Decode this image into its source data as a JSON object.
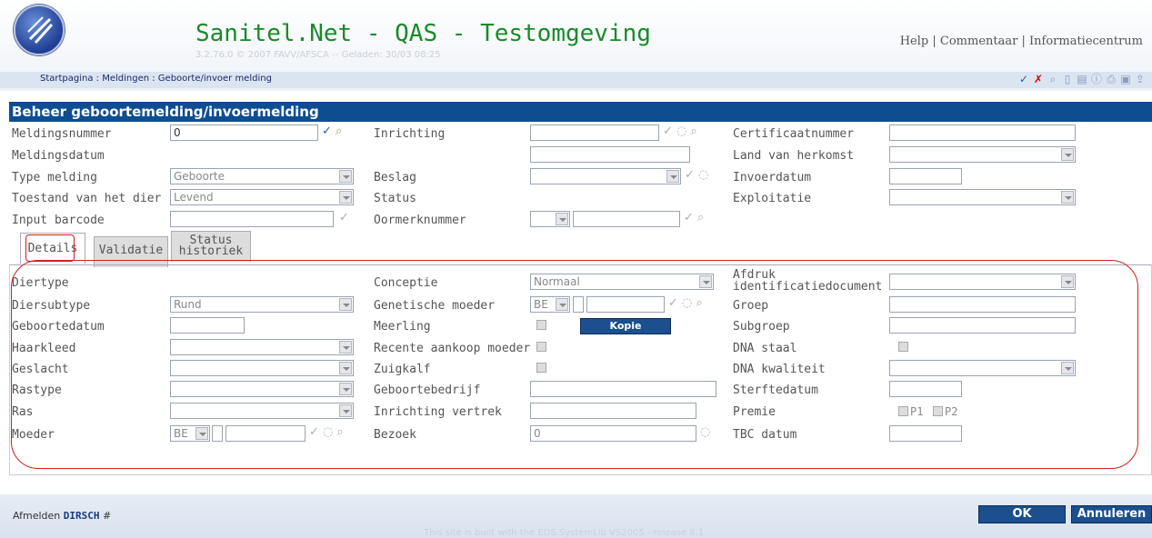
{
  "header": {
    "title": "Sanitel.Net - QAS - Testomgeving",
    "version": "3.2.76.0 © 2007 FAVV/AFSCA -- Geladen: 30/03 08:25",
    "links": [
      "Help",
      "Commentaar",
      "Informatiecentrum"
    ],
    "separator": "|"
  },
  "breadcrumb": "Startpagina : Meldingen : Geboorte/invoer melding",
  "page_title": "Beheer geboortemelding/invoermelding",
  "form": {
    "meldingsnummer": {
      "label": "Meldingsnummer",
      "value": "0"
    },
    "meldingsdatum": {
      "label": "Meldingsdatum"
    },
    "type_melding": {
      "label": "Type melding",
      "value": "Geboorte"
    },
    "toestand": {
      "label": "Toestand van het dier",
      "value": "Levend"
    },
    "input_barcode": {
      "label": "Input barcode",
      "value": ""
    },
    "inrichting": {
      "label": "Inrichting",
      "value": ""
    },
    "beslag": {
      "label": "Beslag",
      "value": ""
    },
    "status": {
      "label": "Status"
    },
    "oormerknummer": {
      "label": "Oormerknummer",
      "value": ""
    },
    "certificaatnummer": {
      "label": "Certificaatnummer",
      "value": ""
    },
    "land_herkomst": {
      "label": "Land van herkomst",
      "value": ""
    },
    "invoerdatum": {
      "label": "Invoerdatum",
      "value": ""
    },
    "exploitatie": {
      "label": "Exploitatie",
      "value": ""
    }
  },
  "tabs": [
    {
      "label": "Details"
    },
    {
      "label": "Validatie"
    },
    {
      "label": "Status historiek",
      "line1": "Status",
      "line2": "historiek"
    }
  ],
  "details": {
    "diertype": {
      "label": "Diertype"
    },
    "diersubtype": {
      "label": "Diersubtype",
      "value": "Rund"
    },
    "geboortedatum": {
      "label": "Geboortedatum",
      "value": ""
    },
    "haarkleed": {
      "label": "Haarkleed",
      "value": ""
    },
    "geslacht": {
      "label": "Geslacht",
      "value": ""
    },
    "rastype": {
      "label": "Rastype",
      "value": ""
    },
    "ras": {
      "label": "Ras",
      "value": ""
    },
    "moeder": {
      "label": "Moeder",
      "country": "BE",
      "value": ""
    },
    "conceptie": {
      "label": "Conceptie",
      "value": "Normaal"
    },
    "genetische_moeder": {
      "label": "Genetische moeder",
      "country": "BE",
      "value": ""
    },
    "meerling": {
      "label": "Meerling"
    },
    "recente_aankoop": {
      "label": "Recente aankoop moeder"
    },
    "zuigkalf": {
      "label": "Zuigkalf"
    },
    "geboortebedrijf": {
      "label": "Geboortebedrijf",
      "value": ""
    },
    "inrichting_vertrek": {
      "label": "Inrichting vertrek",
      "value": ""
    },
    "bezoek": {
      "label": "Bezoek",
      "value": "0"
    },
    "afdruk": {
      "label_line1": "Afdruk",
      "label_line2": "identificatiedocument",
      "value": ""
    },
    "groep": {
      "label": "Groep",
      "value": ""
    },
    "subgroep": {
      "label": "Subgroep",
      "value": ""
    },
    "dna_staal": {
      "label": "DNA staal"
    },
    "dna_kwaliteit": {
      "label": "DNA kwaliteit",
      "value": ""
    },
    "sterftedatum": {
      "label": "Sterftedatum",
      "value": ""
    },
    "premie": {
      "label": "Premie",
      "p1": "P1",
      "p2": "P2"
    },
    "tbc_datum": {
      "label": "TBC datum",
      "value": ""
    },
    "kopie_button": "Kopie"
  },
  "footer": {
    "afmelden": "Afmelden",
    "user": "DIRSCH",
    "hash": "#",
    "note": "This site is built with the EDS.SystemLib VS2005 - release 8.1",
    "ok": "OK",
    "annuleren": "Annuleren"
  },
  "colors": {
    "title_green": "#1a8a2a",
    "bar_blue": "#0f4d91",
    "highlight_red": "#d02020"
  }
}
